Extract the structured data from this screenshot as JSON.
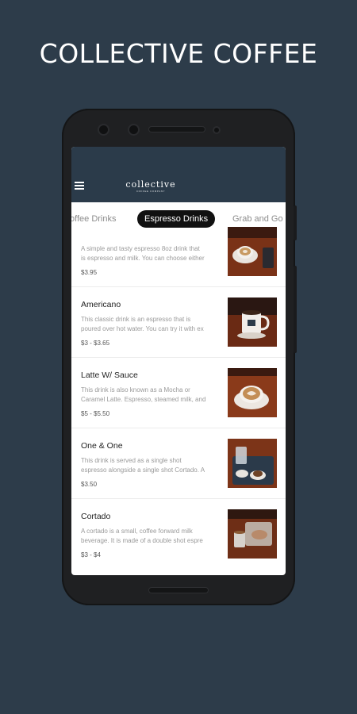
{
  "headline": "COLLECTIVE COFFEE",
  "app": {
    "logo_text": "collective",
    "logo_subtext": "COFFEE COMPANY",
    "colors": {
      "appbar": "#2b3b4a",
      "accent_tab": "#111111",
      "background": "#2d3c4a"
    }
  },
  "tabs": [
    {
      "label": "Coffee Drinks",
      "visible_label": "offee Drinks",
      "active": false
    },
    {
      "label": "Espresso Drinks",
      "active": true
    },
    {
      "label": "Grab and Go",
      "visible_label": "Grab and Go",
      "active": false
    }
  ],
  "items": [
    {
      "title": "",
      "description_line1": "A simple and tasty espresso 8oz drink that",
      "description_line2": "is espresso and milk. You can choose either",
      "price": "$3.95",
      "photo": "flat-white-photo"
    },
    {
      "title": "Americano",
      "description_line1": "This classic drink is an espresso that is",
      "description_line2": "poured over hot water. You can try it with ex",
      "price": "$3 - $3.65",
      "photo": "americano-mug-photo"
    },
    {
      "title": "Latte W/ Sauce",
      "description_line1": "This drink is also known as a Mocha or",
      "description_line2": "Caramel Latte. Espresso, steamed milk, and",
      "price": "$5 - $5.50",
      "photo": "latte-photo"
    },
    {
      "title": "One & One",
      "description_line1": "This drink is served as a single shot",
      "description_line2": "espresso alongside a single shot Cortado. A",
      "price": "$3.50",
      "photo": "one-and-one-photo"
    },
    {
      "title": "Cortado",
      "description_line1": "A cortado is a small, coffee forward milk",
      "description_line2": "beverage. It is made of a double shot espre",
      "price": "$3 - $4",
      "photo": "cortado-photo"
    }
  ]
}
